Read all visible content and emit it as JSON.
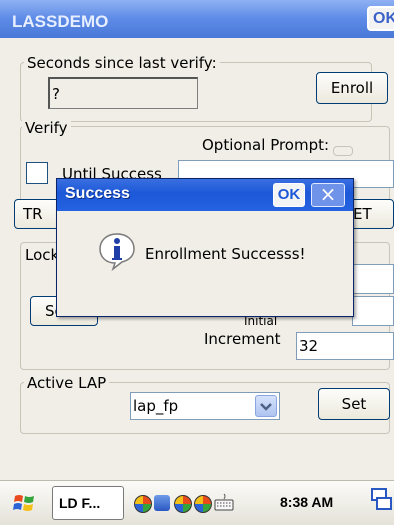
{
  "window": {
    "title": "LASSDEMO",
    "ok_label": "OK"
  },
  "seconds_group": {
    "label": "Seconds since last verify:",
    "value": "?",
    "enroll_label": "Enroll"
  },
  "verify_group": {
    "label": "Verify",
    "optional_prompt_label": "Optional Prompt:",
    "until_success_label": "Until Success",
    "button_left_partial": "TR",
    "button_right_partial": "ET"
  },
  "lock_group": {
    "label_partial": "Lock",
    "set_button_partial": "Se",
    "initial_label_partial": "Initial",
    "increment_label": "Increment",
    "increment_value": "32"
  },
  "active_lap_group": {
    "label": "Active LAP",
    "selected_value": "lap_fp",
    "set_label": "Set"
  },
  "dialog": {
    "title": "Success",
    "ok_label": "OK",
    "close_label": "×",
    "message": "Enrollment Successs!"
  },
  "taskbar": {
    "task_button_label": "LD F...",
    "clock": "8:38 AM"
  },
  "colors": {
    "title_blue": "#5c8ae6",
    "dialog_title_blue": "#1c58d8",
    "background": "#f0eee6"
  }
}
